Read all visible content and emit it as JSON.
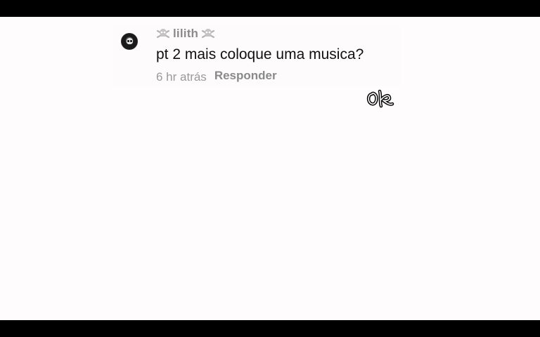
{
  "comment": {
    "username": "lilith",
    "text": "pt 2 mais coloque uma musica?",
    "timestamp": "6 hr atrás",
    "reply_label": "Responder",
    "username_decoration_icon": "skull-crossbones-icon"
  },
  "watermark": {
    "text": "ok",
    "icon": "signature-watermark"
  },
  "colors": {
    "background": "#fefcfd",
    "letterbox": "#000000",
    "comment_text": "#111111",
    "muted_text": "#8a8a8a"
  }
}
